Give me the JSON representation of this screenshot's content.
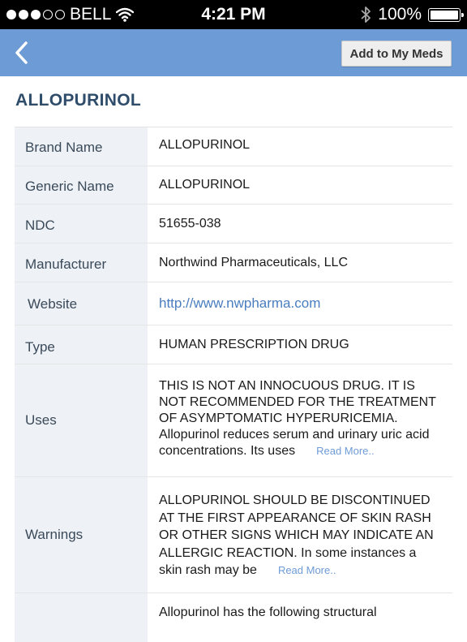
{
  "status_bar": {
    "carrier": "BELL",
    "time": "4:21 PM",
    "battery": "100%",
    "signal_bars": 3,
    "signal_total": 5
  },
  "nav": {
    "back_icon": "chevron-left-icon",
    "add_button": "Add to My Meds"
  },
  "drug": {
    "title": "ALLOPURINOL",
    "rows": [
      {
        "label": "Brand Name",
        "value": "ALLOPURINOL"
      },
      {
        "label": "Generic Name",
        "value": "ALLOPURINOL"
      },
      {
        "label": "NDC",
        "value": "51655-038"
      },
      {
        "label": "Manufacturer",
        "value": "Northwind Pharmaceuticals, LLC"
      },
      {
        "label": "Website",
        "value": "http://www.nwpharma.com"
      },
      {
        "label": "Type",
        "value": "HUMAN PRESCRIPTION DRUG"
      },
      {
        "label": "Uses",
        "value": "THIS IS NOT AN INNOCUOUS DRUG. IT IS NOT RECOMMENDED FOR THE TREATMENT OF ASYMPTOMATIC HYPERURICEMIA. Allopurinol reduces serum and urinary uric acid concentrations. Its uses",
        "more": "Read More.."
      },
      {
        "label": "Warnings",
        "value": "ALLOPURINOL SHOULD BE DISCONTINUED AT THE FIRST APPEARANCE OF SKIN RASH OR OTHER SIGNS WHICH MAY INDICATE AN ALLERGIC REACTION. In some instances a skin rash may be",
        "more": "Read More.."
      },
      {
        "label": "",
        "value": "Allopurinol has the following structural"
      }
    ]
  },
  "colors": {
    "nav": "#6d9bd6",
    "title": "#2f4d6b",
    "label_bg": "#eef1f5",
    "link": "#4a7dbf"
  }
}
